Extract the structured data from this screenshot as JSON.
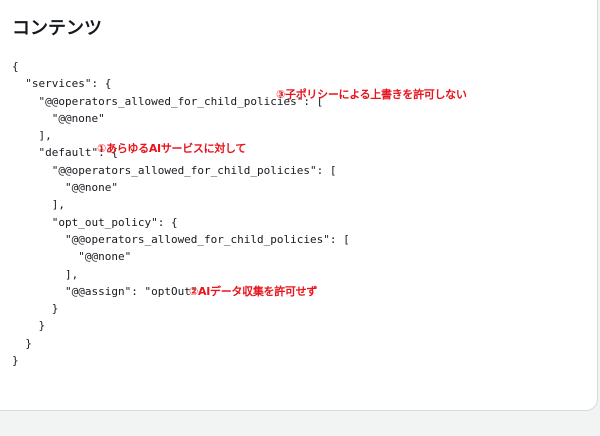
{
  "section": {
    "title": "コンテンツ"
  },
  "code_lines": [
    "{",
    "  \"services\": {",
    "    \"@@operators_allowed_for_child_policies\": [",
    "      \"@@none\"",
    "    ],",
    "    \"default\": {",
    "      \"@@operators_allowed_for_child_policies\": [",
    "        \"@@none\"",
    "      ],",
    "      \"opt_out_policy\": {",
    "        \"@@operators_allowed_for_child_policies\": [",
    "          \"@@none\"",
    "        ],",
    "        \"@@assign\": \"optOut\"",
    "      }",
    "    }",
    "  }",
    "}"
  ],
  "annotations": {
    "note_1": "①あらゆるAIサービスに対して",
    "note_2": "②AIデータ収集を許可せず",
    "note_3": "③子ポリシーによる上書きを許可しない"
  },
  "colors": {
    "annotation": "#e8141c",
    "text": "#16191f",
    "background": "#f2f3f3",
    "card": "#ffffff"
  }
}
